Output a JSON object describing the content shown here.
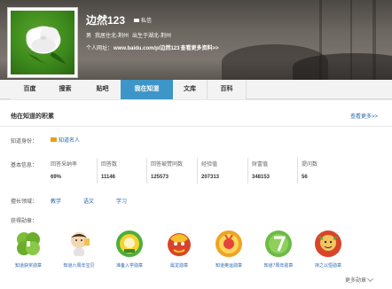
{
  "profile": {
    "username": "边然123",
    "message_label": "私信",
    "gender": "男",
    "residence": "我居住北-荆州",
    "birthplace": "出生于湖北-荆州",
    "homepage_label": "个人网址：",
    "homepage_url": "www.baidu.com/p/边然123",
    "more_info": "查看更多资料>>"
  },
  "tabs": [
    "百度",
    "搜索",
    "贴吧",
    "我在知道",
    "文库",
    "百科"
  ],
  "active_tab": 3,
  "section": {
    "title": "他在知道的积累",
    "more_link": "查看更多>>"
  },
  "identity": {
    "label": "知道身份：",
    "value": "知道名人"
  },
  "stats": {
    "label": "基本信息：",
    "items": [
      {
        "name": "回答采纳率",
        "value": "69%"
      },
      {
        "name": "回答数",
        "value": "11146"
      },
      {
        "name": "回答被赞同数",
        "value": "125573"
      },
      {
        "name": "经验值",
        "value": "207313"
      },
      {
        "name": "财富值",
        "value": "348153"
      },
      {
        "name": "提问数",
        "value": "56"
      }
    ]
  },
  "skills": {
    "label": "擅长领域：",
    "items": [
      "教学",
      "语文",
      "学习"
    ]
  },
  "badges": {
    "label": "获得勋章：",
    "items": [
      {
        "name": "知道获奖勋章",
        "color": "#7cbd3a"
      },
      {
        "name": "知道六周年宝贝",
        "color": "#f2d7b5"
      },
      {
        "name": "准备入学勋章",
        "color": "#4fae3a"
      },
      {
        "name": "属龙勋章",
        "color": "#d8442a"
      },
      {
        "name": "知道奥运勋章",
        "color": "#f0a324"
      },
      {
        "name": "知道7周年勋章",
        "color": "#6cbb45"
      },
      {
        "name": "持之以恒勋章",
        "color": "#d9452b"
      }
    ],
    "more": "更多勋章"
  }
}
